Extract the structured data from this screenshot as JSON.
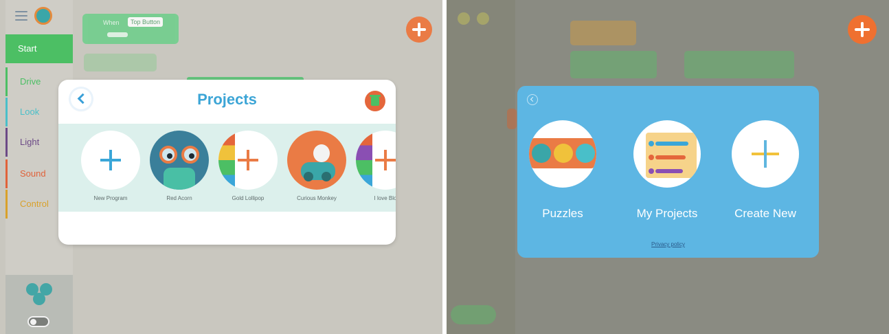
{
  "left_screen": {
    "sidebar": {
      "categories": [
        {
          "label": "Start"
        },
        {
          "label": "Drive"
        },
        {
          "label": "Look"
        },
        {
          "label": "Light"
        },
        {
          "label": "Sound"
        },
        {
          "label": "Control"
        }
      ]
    },
    "canvas": {
      "when_block": {
        "label": "When",
        "trigger": "Top Button"
      }
    },
    "projects_dialog": {
      "title": "Projects",
      "projects": [
        {
          "name": "New Program"
        },
        {
          "name": "Red Acorn"
        },
        {
          "name": "Gold Lollipop"
        },
        {
          "name": "Curious Monkey"
        },
        {
          "name": "I love Blo"
        }
      ]
    }
  },
  "right_screen": {
    "home_dialog": {
      "options": [
        {
          "label": "Puzzles"
        },
        {
          "label": "My Projects"
        },
        {
          "label": "Create New"
        }
      ],
      "privacy_link": "Privacy policy"
    }
  },
  "colors": {
    "start_green": "#4cbf64",
    "title_blue": "#3ca5d6",
    "accent_orange": "#ea7b45",
    "dialog_blue": "#5db6e3"
  }
}
